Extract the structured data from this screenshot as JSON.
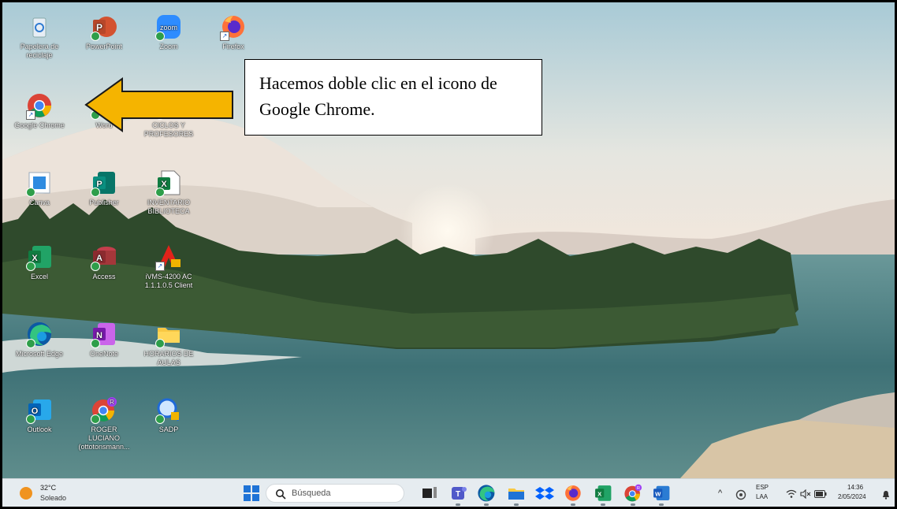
{
  "desktop": {
    "icons": [
      {
        "label": "Papelera de reciclaje",
        "icon": "recycle-bin-icon"
      },
      {
        "label": "PowerPoint",
        "icon": "powerpoint-icon"
      },
      {
        "label": "Zoom",
        "icon": "zoom-icon"
      },
      {
        "label": "Firefox",
        "icon": "firefox-icon"
      },
      {
        "label": "Google Chrome",
        "icon": "chrome-icon"
      },
      {
        "label": "Word",
        "icon": "word-icon"
      },
      {
        "label": "CICLOS Y PROFESORES",
        "icon": "folder-icon"
      },
      {
        "label": "Canva",
        "icon": "canva-icon"
      },
      {
        "label": "Publisher",
        "icon": "publisher-icon"
      },
      {
        "label": "INVENTARIO BIBLIOTECA",
        "icon": "excel-file-icon"
      },
      {
        "label": "Excel",
        "icon": "excel-icon"
      },
      {
        "label": "Access",
        "icon": "access-icon"
      },
      {
        "label": "iVMS-4200 AC 1.1.1.0.5 Client",
        "icon": "ivms-icon"
      },
      {
        "label": "Microsoft Edge",
        "icon": "edge-icon"
      },
      {
        "label": "OneNote",
        "icon": "onenote-icon"
      },
      {
        "label": "HORARIOS DE AULAS",
        "icon": "folder-icon"
      },
      {
        "label": "Outlook",
        "icon": "outlook-icon"
      },
      {
        "label": "ROGER LUCIANO (ottotonsmann...",
        "icon": "chrome-profile-icon"
      },
      {
        "label": "SADP",
        "icon": "sadp-icon"
      }
    ],
    "zoom_logo_text": "zoom"
  },
  "callout": {
    "text": "Hacemos doble clic en el icono de Google Chrome."
  },
  "taskbar": {
    "weather": {
      "temp": "32°C",
      "condition": "Soleado"
    },
    "search_placeholder": "Búsqueda",
    "pinned": [
      "task-view-icon",
      "teams-icon",
      "edge-icon",
      "file-explorer-icon",
      "dropbox-icon",
      "firefox-icon",
      "excel-icon",
      "chrome-profile-icon",
      "word-icon"
    ],
    "tray": {
      "lang_line1": "ESP",
      "lang_line2": "LAA",
      "time": "14:36",
      "date": "2/05/2024"
    }
  },
  "colors": {
    "arrow_fill": "#f5b400",
    "taskbar_bg": "#e6ecf0",
    "chrome_red": "#db4437",
    "chrome_green": "#0f9d58",
    "chrome_yellow": "#f4b400",
    "chrome_blue": "#4285f4"
  }
}
